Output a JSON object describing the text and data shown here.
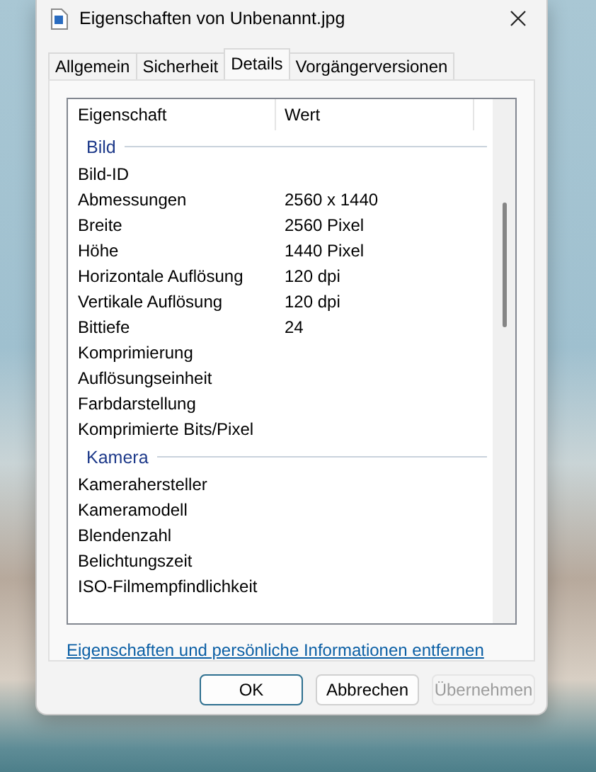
{
  "window": {
    "title": "Eigenschaften von Unbenannt.jpg"
  },
  "tabs": [
    {
      "label": "Allgemein",
      "selected": false
    },
    {
      "label": "Sicherheit",
      "selected": false
    },
    {
      "label": "Details",
      "selected": true
    },
    {
      "label": "Vorgängerversionen",
      "selected": false
    }
  ],
  "table": {
    "columns": [
      "Eigenschaft",
      "Wert"
    ],
    "groups": [
      {
        "title": "Bild",
        "rows": [
          {
            "property": "Bild-ID"
          },
          {
            "property": "Abmessungen",
            "value": "2560 x 1440"
          },
          {
            "property": "Breite",
            "value": "2560 Pixel"
          },
          {
            "property": "Höhe",
            "value": "1440 Pixel"
          },
          {
            "property": "Horizontale Auflösung",
            "value": "120 dpi"
          },
          {
            "property": "Vertikale Auflösung",
            "value": "120 dpi"
          },
          {
            "property": "Bittiefe",
            "value": "24"
          },
          {
            "property": "Komprimierung"
          },
          {
            "property": "Auflösungseinheit"
          },
          {
            "property": "Farbdarstellung"
          },
          {
            "property": "Komprimierte Bits/Pixel"
          }
        ]
      },
      {
        "title": "Kamera",
        "rows": [
          {
            "property": "Kamerahersteller"
          },
          {
            "property": "Kameramodell"
          },
          {
            "property": "Blendenzahl"
          },
          {
            "property": "Belichtungszeit"
          },
          {
            "property": "ISO-Filmempfindlichkeit"
          }
        ]
      }
    ]
  },
  "link": "Eigenschaften und persönliche Informationen entfernen",
  "buttons": [
    {
      "label": "OK",
      "kind": "default",
      "disabled": false
    },
    {
      "label": "Abbrechen",
      "kind": "normal",
      "disabled": false
    },
    {
      "label": "Übernehmen",
      "kind": "normal",
      "disabled": true
    }
  ]
}
